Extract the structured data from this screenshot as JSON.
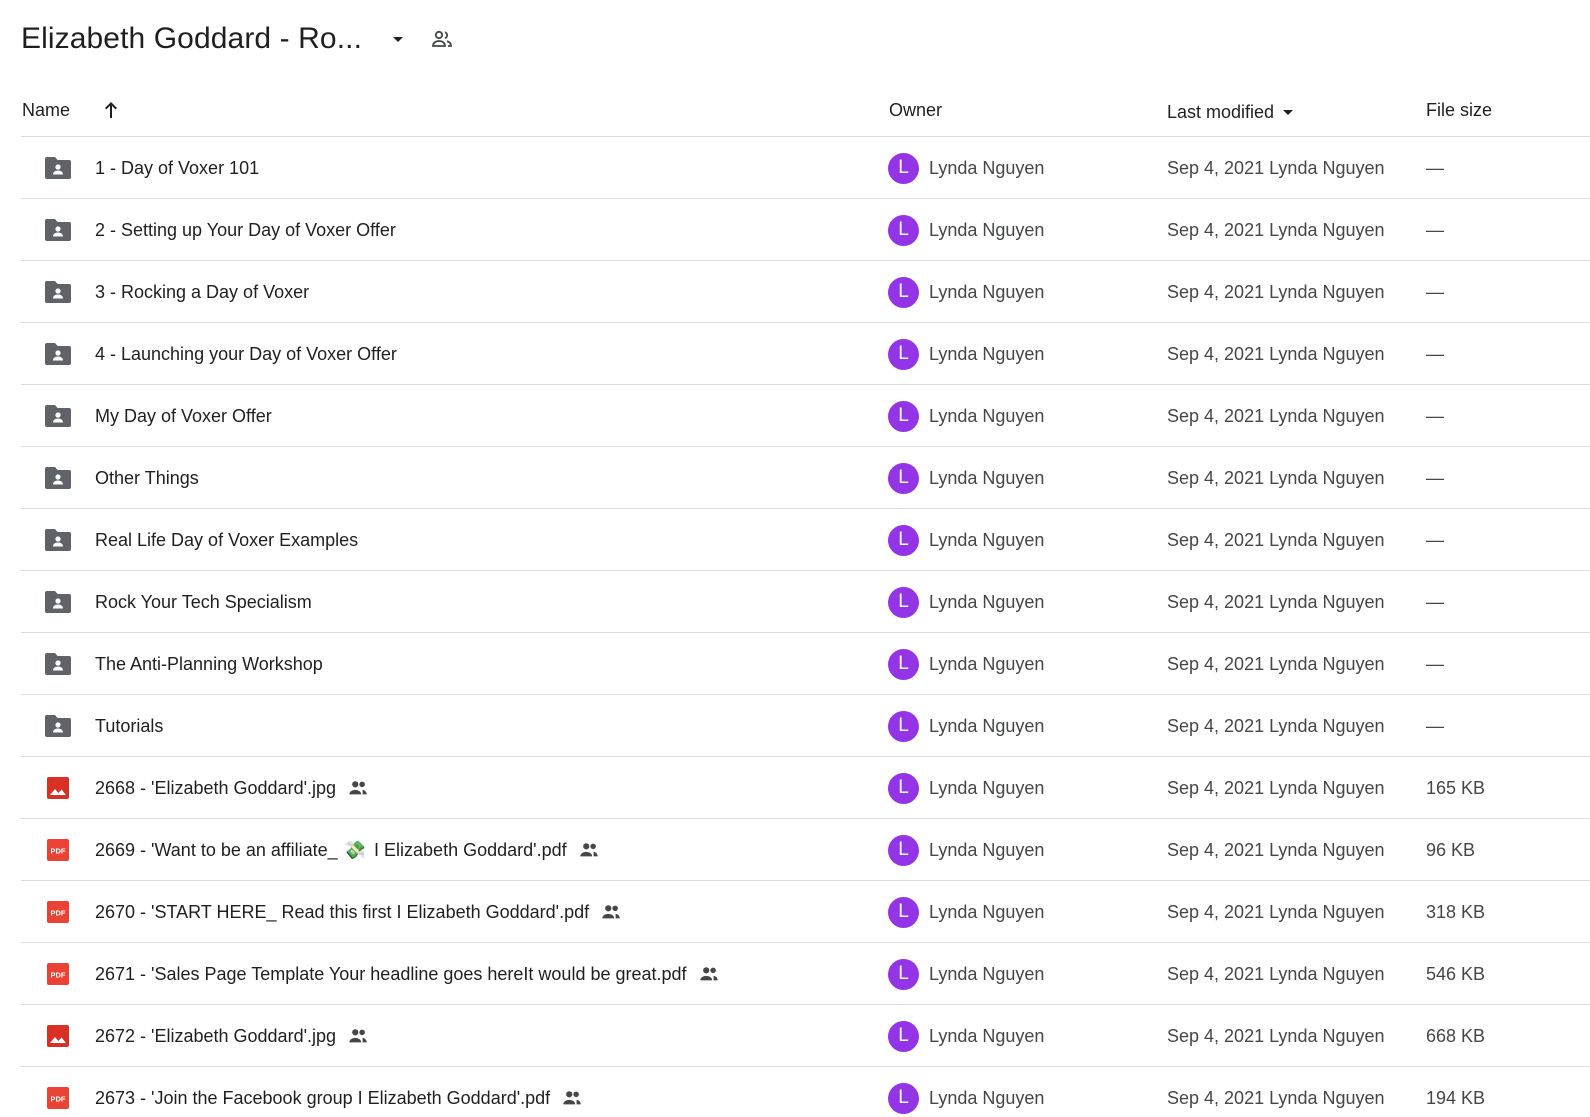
{
  "header": {
    "folder_title": "Elizabeth Goddard - Ro...",
    "dropdown_icon": "arrow-drop-down-icon",
    "shared_icon": "people-outline-icon"
  },
  "columns": {
    "name": "Name",
    "owner": "Owner",
    "last_modified": "Last modified",
    "file_size": "File size"
  },
  "colors": {
    "avatar": "#9334e6",
    "folder_icon": "#5f6368",
    "image_icon": "#d93025",
    "pdf_icon": "#ea4335",
    "divider": "#dadce0"
  },
  "rows": [
    {
      "type": "folder",
      "name": "1 - Day of Voxer 101",
      "shared": false,
      "owner_initial": "L",
      "owner": "Lynda Nguyen",
      "modified": "Sep 4, 2021 Lynda Nguyen",
      "size": "—"
    },
    {
      "type": "folder",
      "name": "2 - Setting up Your Day of Voxer Offer",
      "shared": false,
      "owner_initial": "L",
      "owner": "Lynda Nguyen",
      "modified": "Sep 4, 2021 Lynda Nguyen",
      "size": "—"
    },
    {
      "type": "folder",
      "name": "3 - Rocking a Day of Voxer",
      "shared": false,
      "owner_initial": "L",
      "owner": "Lynda Nguyen",
      "modified": "Sep 4, 2021 Lynda Nguyen",
      "size": "—"
    },
    {
      "type": "folder",
      "name": "4 - Launching your Day of Voxer Offer",
      "shared": false,
      "owner_initial": "L",
      "owner": "Lynda Nguyen",
      "modified": "Sep 4, 2021 Lynda Nguyen",
      "size": "—"
    },
    {
      "type": "folder",
      "name": "My Day of Voxer Offer",
      "shared": false,
      "owner_initial": "L",
      "owner": "Lynda Nguyen",
      "modified": "Sep 4, 2021 Lynda Nguyen",
      "size": "—"
    },
    {
      "type": "folder",
      "name": "Other Things",
      "shared": false,
      "owner_initial": "L",
      "owner": "Lynda Nguyen",
      "modified": "Sep 4, 2021 Lynda Nguyen",
      "size": "—"
    },
    {
      "type": "folder",
      "name": "Real Life Day of Voxer Examples",
      "shared": false,
      "owner_initial": "L",
      "owner": "Lynda Nguyen",
      "modified": "Sep 4, 2021 Lynda Nguyen",
      "size": "—"
    },
    {
      "type": "folder",
      "name": "Rock Your Tech Specialism",
      "shared": false,
      "owner_initial": "L",
      "owner": "Lynda Nguyen",
      "modified": "Sep 4, 2021 Lynda Nguyen",
      "size": "—"
    },
    {
      "type": "folder",
      "name": "The Anti-Planning Workshop",
      "shared": false,
      "owner_initial": "L",
      "owner": "Lynda Nguyen",
      "modified": "Sep 4, 2021 Lynda Nguyen",
      "size": "—"
    },
    {
      "type": "folder",
      "name": "Tutorials",
      "shared": false,
      "owner_initial": "L",
      "owner": "Lynda Nguyen",
      "modified": "Sep 4, 2021 Lynda Nguyen",
      "size": "—"
    },
    {
      "type": "image",
      "name": "2668 - 'Elizabeth Goddard'.jpg",
      "shared": true,
      "owner_initial": "L",
      "owner": "Lynda Nguyen",
      "modified": "Sep 4, 2021 Lynda Nguyen",
      "size": "165 KB"
    },
    {
      "type": "pdf",
      "name_before_emoji": "2669 - 'Want to be an affiliate_",
      "emoji": "💸",
      "name_after_emoji": "I Elizabeth Goddard'.pdf",
      "shared": true,
      "owner_initial": "L",
      "owner": "Lynda Nguyen",
      "modified": "Sep 4, 2021 Lynda Nguyen",
      "size": "96 KB"
    },
    {
      "type": "pdf",
      "name": "2670 - 'START HERE_ Read this first I Elizabeth Goddard'.pdf",
      "shared": true,
      "owner_initial": "L",
      "owner": "Lynda Nguyen",
      "modified": "Sep 4, 2021 Lynda Nguyen",
      "size": "318 KB"
    },
    {
      "type": "pdf",
      "name": "2671 - 'Sales Page Template Your headline goes hereIt would be great.pdf",
      "shared": true,
      "owner_initial": "L",
      "owner": "Lynda Nguyen",
      "modified": "Sep 4, 2021 Lynda Nguyen",
      "size": "546 KB"
    },
    {
      "type": "image",
      "name": "2672 - 'Elizabeth Goddard'.jpg",
      "shared": true,
      "owner_initial": "L",
      "owner": "Lynda Nguyen",
      "modified": "Sep 4, 2021 Lynda Nguyen",
      "size": "668 KB"
    },
    {
      "type": "pdf",
      "name": "2673 - 'Join the Facebook group I Elizabeth Goddard'.pdf",
      "shared": true,
      "owner_initial": "L",
      "owner": "Lynda Nguyen",
      "modified": "Sep 4, 2021 Lynda Nguyen",
      "size": "194 KB"
    }
  ]
}
